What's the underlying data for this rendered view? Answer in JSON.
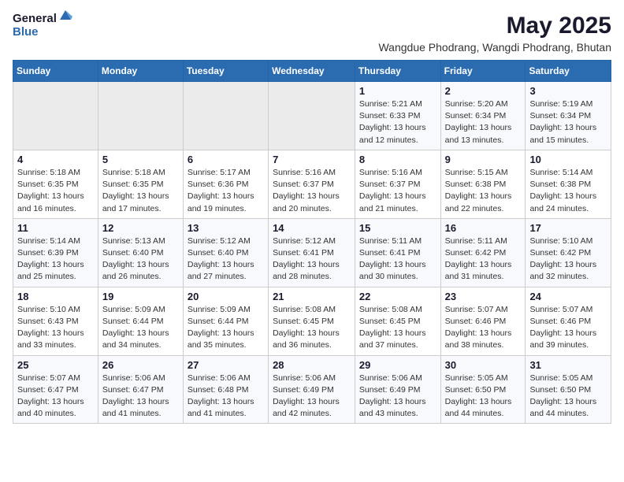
{
  "logo": {
    "general": "General",
    "blue": "Blue"
  },
  "title": "May 2025",
  "location": "Wangdue Phodrang, Wangdi Phodrang, Bhutan",
  "days_of_week": [
    "Sunday",
    "Monday",
    "Tuesday",
    "Wednesday",
    "Thursday",
    "Friday",
    "Saturday"
  ],
  "weeks": [
    [
      {
        "day": "",
        "info": ""
      },
      {
        "day": "",
        "info": ""
      },
      {
        "day": "",
        "info": ""
      },
      {
        "day": "",
        "info": ""
      },
      {
        "day": "1",
        "info": "Sunrise: 5:21 AM\nSunset: 6:33 PM\nDaylight: 13 hours and 12 minutes."
      },
      {
        "day": "2",
        "info": "Sunrise: 5:20 AM\nSunset: 6:34 PM\nDaylight: 13 hours and 13 minutes."
      },
      {
        "day": "3",
        "info": "Sunrise: 5:19 AM\nSunset: 6:34 PM\nDaylight: 13 hours and 15 minutes."
      }
    ],
    [
      {
        "day": "4",
        "info": "Sunrise: 5:18 AM\nSunset: 6:35 PM\nDaylight: 13 hours and 16 minutes."
      },
      {
        "day": "5",
        "info": "Sunrise: 5:18 AM\nSunset: 6:35 PM\nDaylight: 13 hours and 17 minutes."
      },
      {
        "day": "6",
        "info": "Sunrise: 5:17 AM\nSunset: 6:36 PM\nDaylight: 13 hours and 19 minutes."
      },
      {
        "day": "7",
        "info": "Sunrise: 5:16 AM\nSunset: 6:37 PM\nDaylight: 13 hours and 20 minutes."
      },
      {
        "day": "8",
        "info": "Sunrise: 5:16 AM\nSunset: 6:37 PM\nDaylight: 13 hours and 21 minutes."
      },
      {
        "day": "9",
        "info": "Sunrise: 5:15 AM\nSunset: 6:38 PM\nDaylight: 13 hours and 22 minutes."
      },
      {
        "day": "10",
        "info": "Sunrise: 5:14 AM\nSunset: 6:38 PM\nDaylight: 13 hours and 24 minutes."
      }
    ],
    [
      {
        "day": "11",
        "info": "Sunrise: 5:14 AM\nSunset: 6:39 PM\nDaylight: 13 hours and 25 minutes."
      },
      {
        "day": "12",
        "info": "Sunrise: 5:13 AM\nSunset: 6:40 PM\nDaylight: 13 hours and 26 minutes."
      },
      {
        "day": "13",
        "info": "Sunrise: 5:12 AM\nSunset: 6:40 PM\nDaylight: 13 hours and 27 minutes."
      },
      {
        "day": "14",
        "info": "Sunrise: 5:12 AM\nSunset: 6:41 PM\nDaylight: 13 hours and 28 minutes."
      },
      {
        "day": "15",
        "info": "Sunrise: 5:11 AM\nSunset: 6:41 PM\nDaylight: 13 hours and 30 minutes."
      },
      {
        "day": "16",
        "info": "Sunrise: 5:11 AM\nSunset: 6:42 PM\nDaylight: 13 hours and 31 minutes."
      },
      {
        "day": "17",
        "info": "Sunrise: 5:10 AM\nSunset: 6:42 PM\nDaylight: 13 hours and 32 minutes."
      }
    ],
    [
      {
        "day": "18",
        "info": "Sunrise: 5:10 AM\nSunset: 6:43 PM\nDaylight: 13 hours and 33 minutes."
      },
      {
        "day": "19",
        "info": "Sunrise: 5:09 AM\nSunset: 6:44 PM\nDaylight: 13 hours and 34 minutes."
      },
      {
        "day": "20",
        "info": "Sunrise: 5:09 AM\nSunset: 6:44 PM\nDaylight: 13 hours and 35 minutes."
      },
      {
        "day": "21",
        "info": "Sunrise: 5:08 AM\nSunset: 6:45 PM\nDaylight: 13 hours and 36 minutes."
      },
      {
        "day": "22",
        "info": "Sunrise: 5:08 AM\nSunset: 6:45 PM\nDaylight: 13 hours and 37 minutes."
      },
      {
        "day": "23",
        "info": "Sunrise: 5:07 AM\nSunset: 6:46 PM\nDaylight: 13 hours and 38 minutes."
      },
      {
        "day": "24",
        "info": "Sunrise: 5:07 AM\nSunset: 6:46 PM\nDaylight: 13 hours and 39 minutes."
      }
    ],
    [
      {
        "day": "25",
        "info": "Sunrise: 5:07 AM\nSunset: 6:47 PM\nDaylight: 13 hours and 40 minutes."
      },
      {
        "day": "26",
        "info": "Sunrise: 5:06 AM\nSunset: 6:47 PM\nDaylight: 13 hours and 41 minutes."
      },
      {
        "day": "27",
        "info": "Sunrise: 5:06 AM\nSunset: 6:48 PM\nDaylight: 13 hours and 41 minutes."
      },
      {
        "day": "28",
        "info": "Sunrise: 5:06 AM\nSunset: 6:49 PM\nDaylight: 13 hours and 42 minutes."
      },
      {
        "day": "29",
        "info": "Sunrise: 5:06 AM\nSunset: 6:49 PM\nDaylight: 13 hours and 43 minutes."
      },
      {
        "day": "30",
        "info": "Sunrise: 5:05 AM\nSunset: 6:50 PM\nDaylight: 13 hours and 44 minutes."
      },
      {
        "day": "31",
        "info": "Sunrise: 5:05 AM\nSunset: 6:50 PM\nDaylight: 13 hours and 44 minutes."
      }
    ]
  ]
}
